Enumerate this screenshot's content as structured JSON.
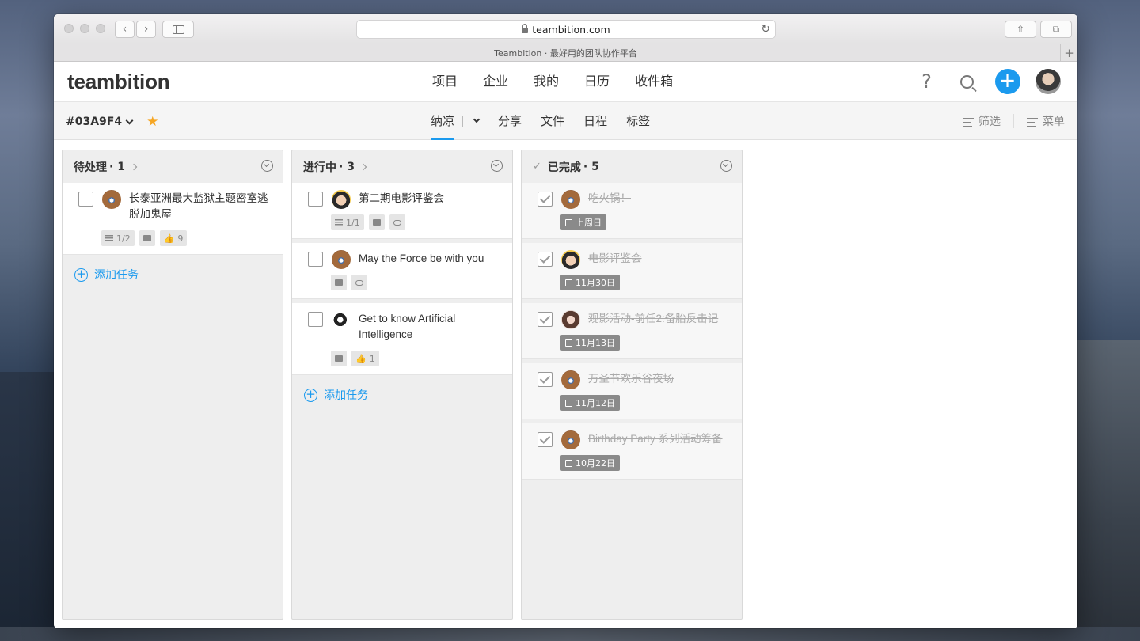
{
  "browser": {
    "url": "teambition.com",
    "tab_title": "Teambition · 最好用的团队协作平台"
  },
  "app": {
    "logo": "teambition",
    "nav": [
      "项目",
      "企业",
      "我的",
      "日历",
      "收件箱"
    ],
    "help": "?",
    "add": "+"
  },
  "project": {
    "name": "#03A9F4",
    "tabs": [
      "纳凉",
      "分享",
      "文件",
      "日程",
      "标签"
    ],
    "active_tab": "纳凉",
    "filter": "筛选",
    "menu": "菜单"
  },
  "columns": [
    {
      "title": "待处理",
      "count": "· 1",
      "tasks": [
        {
          "title": "长泰亚洲最大监狱主题密室逃脱加鬼屋",
          "subtasks": "1/2",
          "likes": "9"
        }
      ],
      "add_label": "添加任务"
    },
    {
      "title": "进行中",
      "count": "· 3",
      "tasks": [
        {
          "title": "第二期电影评鉴会",
          "subtasks": "1/1"
        },
        {
          "title": "May the Force be with you"
        },
        {
          "title": "Get to know Artificial Intelligence",
          "likes": "1"
        }
      ],
      "add_label": "添加任务"
    },
    {
      "title": "已完成",
      "count": "· 5",
      "tasks": [
        {
          "title": "吃火锅！",
          "date": "上周日"
        },
        {
          "title": "电影评鉴会",
          "date": "11月30日"
        },
        {
          "title": "观影活动-前任2:备胎反击记",
          "date": "11月13日"
        },
        {
          "title": "万圣节欢乐谷夜场",
          "date": "11月12日"
        },
        {
          "title": "Birthday Party 系列活动筹备",
          "date": "10月22日"
        }
      ]
    }
  ],
  "colors": {
    "accent": "#1b9aee",
    "star": "#f6a623"
  }
}
